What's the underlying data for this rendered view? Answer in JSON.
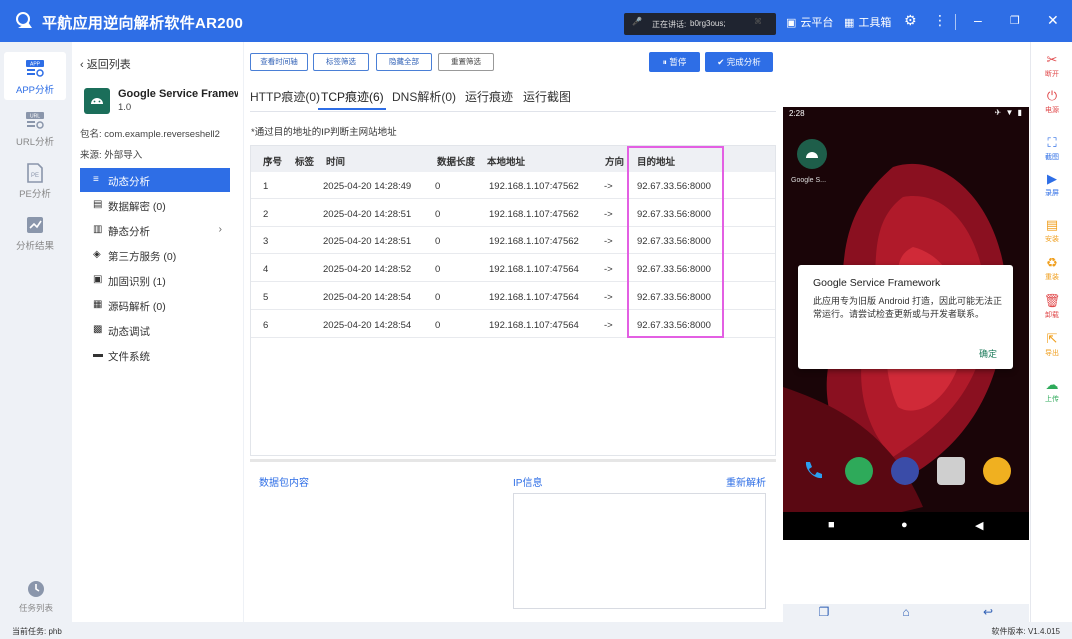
{
  "window": {
    "title": "平航应用逆向解析软件AR200"
  },
  "speaking": {
    "label": "正在讲话:",
    "name": "b0rg3ous;"
  },
  "header": {
    "cloud": "云平台",
    "toolbox": "工具箱"
  },
  "nav": [
    {
      "label": "APP分析",
      "badge": "APP"
    },
    {
      "label": "URL分析",
      "badge": "URL"
    },
    {
      "label": "PE分析",
      "badge": "PE"
    },
    {
      "label": "分析结果",
      "badge": ""
    }
  ],
  "task_list": "任务列表",
  "sidebar": {
    "back": "返回列表",
    "app_name": "Google Service Framework",
    "app_version": "1.0",
    "package_label": "包名:",
    "package": "com.example.reverseshell2",
    "source_label": "来源:",
    "source": "外部导入",
    "menu": [
      {
        "label": "动态分析",
        "icon": "≡"
      },
      {
        "label": "数据解密 (0)",
        "icon": "▤"
      },
      {
        "label": "静态分析",
        "icon": "▥"
      },
      {
        "label": "第三方服务 (0)",
        "icon": "◈"
      },
      {
        "label": "加固识别 (1)",
        "icon": "▣"
      },
      {
        "label": "源码解析 (0)",
        "icon": "▦"
      },
      {
        "label": "动态调试",
        "icon": "▩"
      },
      {
        "label": "文件系统",
        "icon": "▬"
      }
    ]
  },
  "toolbar": {
    "time_axis": "查看时间轴",
    "tag_filter": "标签筛选",
    "hide_all": "隐藏全部",
    "reset_filter": "重置筛选",
    "pause": "暂停",
    "finish": "完成分析"
  },
  "tabs": [
    "HTTP痕迹(0)",
    "TCP痕迹(6)",
    "DNS解析(0)",
    "运行痕迹",
    "运行截图"
  ],
  "note": "*通过目的地址的IP判断主网站地址",
  "table": {
    "headers": [
      "序号",
      "标签",
      "时间",
      "数据长度",
      "本地地址",
      "方向",
      "目的地址"
    ],
    "rows": [
      [
        "1",
        "",
        "2025-04-20 14:28:49",
        "0",
        "192.168.1.107:47562",
        "->",
        "92.67.33.56:8000"
      ],
      [
        "2",
        "",
        "2025-04-20 14:28:51",
        "0",
        "192.168.1.107:47562",
        "->",
        "92.67.33.56:8000"
      ],
      [
        "3",
        "",
        "2025-04-20 14:28:51",
        "0",
        "192.168.1.107:47562",
        "->",
        "92.67.33.56:8000"
      ],
      [
        "4",
        "",
        "2025-04-20 14:28:52",
        "0",
        "192.168.1.107:47564",
        "->",
        "92.67.33.56:8000"
      ],
      [
        "5",
        "",
        "2025-04-20 14:28:54",
        "0",
        "192.168.1.107:47564",
        "->",
        "92.67.33.56:8000"
      ],
      [
        "6",
        "",
        "2025-04-20 14:28:54",
        "0",
        "192.168.1.107:47564",
        "->",
        "92.67.33.56:8000"
      ]
    ]
  },
  "bottom": {
    "packet": "数据包内容",
    "ip_info": "IP信息",
    "reparse": "重新解析"
  },
  "phone": {
    "time": "2:28",
    "tile_label": "Google S...",
    "dialog_title": "Google Service Framework",
    "dialog_message": "此应用专为旧版 Android 打造，因此可能无法正常运行。请尝试检查更新或与开发者联系。",
    "dialog_ok": "确定"
  },
  "tools": [
    {
      "label": "断开",
      "icon": "✂"
    },
    {
      "label": "电源",
      "icon": "⏻"
    },
    {
      "label": "截图",
      "icon": "⛶"
    },
    {
      "label": "录屏",
      "icon": "▶"
    },
    {
      "label": "安装",
      "icon": "▤"
    },
    {
      "label": "重装",
      "icon": "♻"
    },
    {
      "label": "卸载",
      "icon": "🗑"
    },
    {
      "label": "导出",
      "icon": "⇱"
    },
    {
      "label": "上传",
      "icon": "☁"
    }
  ],
  "status": {
    "current_task_label": "当前任务:",
    "current_task": "phb",
    "version_label": "软件版本:",
    "version": "V1.4.015"
  }
}
